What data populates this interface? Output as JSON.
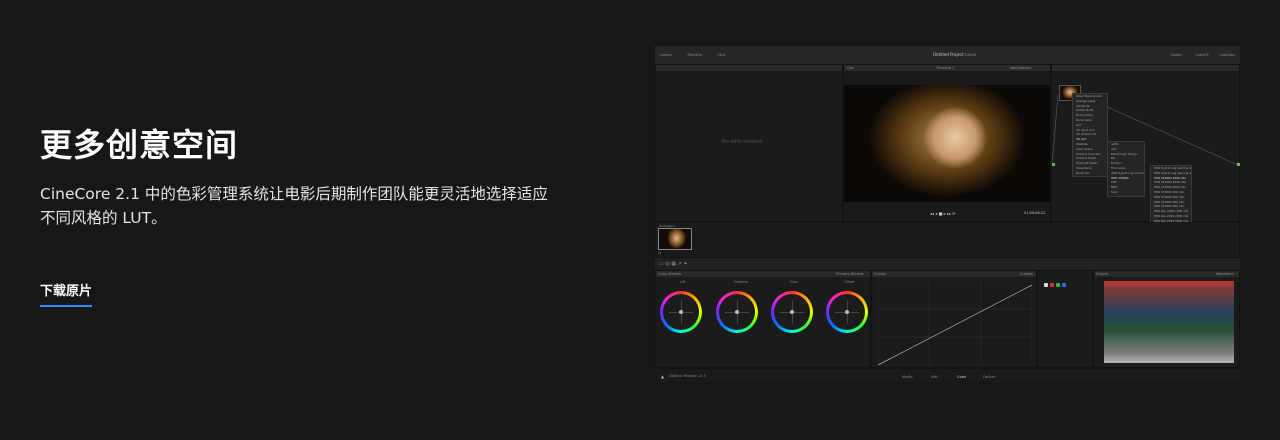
{
  "hero": {
    "heading": "更多创意空间",
    "description": "CineCore 2.1 中的色彩管理系统让电影后期制作团队能更灵活地选择适应不同风格的 LUT。",
    "download_label": "下载原片"
  },
  "app": {
    "project_title": "Untitled Project",
    "project_status": "Edited",
    "top_left": [
      "Gallery",
      "Timeline",
      "Clips"
    ],
    "top_right": [
      "Nodes",
      "OpenFX",
      "Lightbox"
    ],
    "viewer": {
      "clip_label": "Clip",
      "timeline_label": "Timeline 1",
      "mode_label": "Workstation",
      "timecode": "01:00:04:22"
    },
    "no_stills_text": "No stills created",
    "clip_thumb_label": "Workstation",
    "clip_thumb_number": "01",
    "panels": {
      "color_wheels": "Color Wheels",
      "primary_wheels": "Primary Wheels",
      "curves": "Curves",
      "custom": "Custom",
      "scopes": "Scopes",
      "waveform": "Waveform"
    },
    "wheels": [
      "Lift",
      "Gamma",
      "Gain",
      "Offset"
    ],
    "context_menu": [
      "Reset Node Grade",
      "Change Label",
      "Add Node",
      "Delete Node",
      "Node Cache",
      "Node Label",
      "LUT",
      "3D Input LUT",
      "3D Output LUT",
      "3D LUT",
      "Stabilize",
      "Color Space",
      "Gamma Override",
      "Shadow Detail",
      "Highlight Detail",
      "Show Node",
      "Node Info"
    ],
    "submenu_1": [
      "ACES",
      "VLC",
      "Blackmagic Design",
      "DJI",
      "DaVinci",
      "Film Looks",
      "HDR Hybrid Log-Gamma",
      "HDR ST2084",
      "LMT",
      "RED",
      "Sony"
    ],
    "submenu_2": [
      "HDR Hybrid Log-Gamma 1000 nits",
      "HDR Hybrid Log-Gamma 2000 nits",
      "HDR ST2084 1000 nits",
      "HDR ST2084 2000 nits",
      "HDR ST2084 4000 nits",
      "HDR ST2084 300 nits",
      "HDR ST2084 500 nits",
      "HDR ST2084 600 nits",
      "HDR ST2084 800 nits",
      "HDR Rec.2020 1000 nits",
      "HDR Rec.2020 2000 nits",
      "HDR Rec.2020 4000 nits"
    ],
    "footer": {
      "app_name": "DaVinci Resolve 12.5",
      "pages": [
        "Media",
        "Edit",
        "Color",
        "Deliver"
      ]
    }
  }
}
